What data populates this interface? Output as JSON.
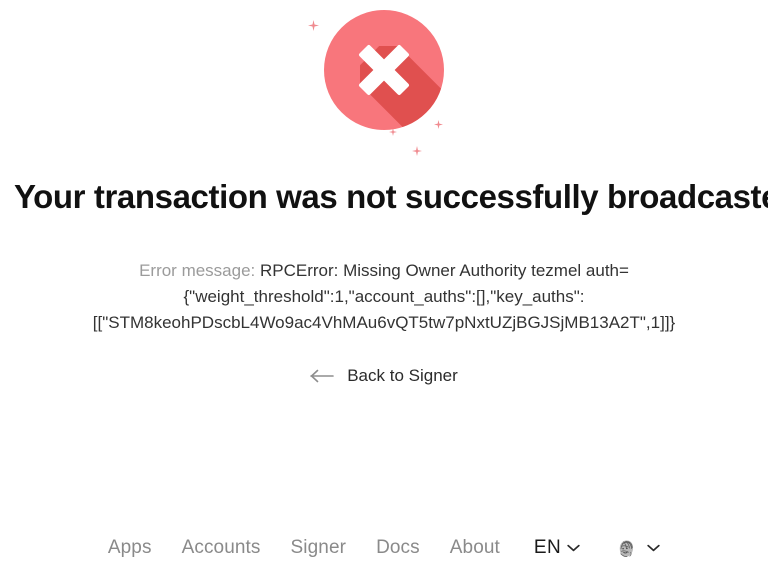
{
  "status_icon": {
    "name": "error-cross-icon",
    "circle_color": "#f8767c",
    "shadow_color": "#e0504f",
    "mark_color": "#ffffff",
    "sparkle_color": "#f08b90"
  },
  "headline": "Your transaction was not successfully broadcasted",
  "error": {
    "label": "Error message:",
    "detail": "RPCError: Missing Owner Authority tezmel auth={\"weight_threshold\":1,\"account_auths\":[],\"key_auths\":[[\"STM8keohPDscbL4Wo9ac4VhMAu6vQT5tw7pNxtUZjBGJSjMB13A2T\",1]]}"
  },
  "back_link": {
    "label": "Back to Signer",
    "arrow_icon": "arrow-left-icon"
  },
  "footer": {
    "nav": [
      {
        "label": "Apps"
      },
      {
        "label": "Accounts"
      },
      {
        "label": "Signer"
      },
      {
        "label": "Docs"
      },
      {
        "label": "About"
      }
    ],
    "language": {
      "code": "EN",
      "chevron_icon": "chevron-down-icon"
    },
    "account": {
      "avatar_icon": "user-avatar",
      "chevron_icon": "chevron-down-icon"
    }
  }
}
